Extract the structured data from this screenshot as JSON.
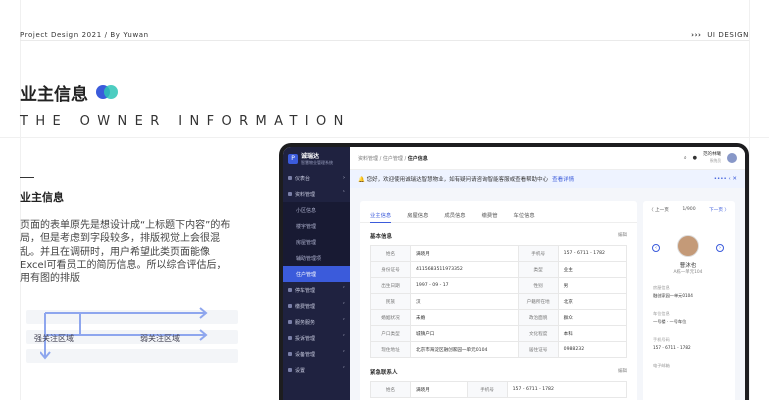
{
  "topbar": {
    "left": "Project Design 2021 / By Yuwan",
    "right_mark": "›››",
    "right": "UI DESIGN"
  },
  "heading": {
    "title": "业主信息",
    "subtitle": "THE OWNER INFORMATION"
  },
  "section": {
    "title": "业主信息",
    "desc": "页面的表单原先是想设计成“上标题下内容”的布局，但是考虑到字段较多，排版视觉上会很混乱。并且在调研时，用户希望此类页面能像Excel可看员工的简历信息。所以综合评估后，用有图的排版"
  },
  "legend": {
    "strong": "强关注区域",
    "weak": "弱关注区域"
  },
  "colors": {
    "blue": "#3b5bdb",
    "teal": "#2ec4b6",
    "sidebar": "#1f2240"
  },
  "app": {
    "brand": "诚瑞达",
    "brand_sub": "智慧物业管理系统",
    "menu": [
      {
        "label": "仪表台",
        "icon": "dashboard-icon"
      },
      {
        "label": "资料管理",
        "icon": "folder-icon",
        "open": true,
        "children": [
          "小区信息",
          "楼宇管理",
          "房屋管理",
          "辅助管理项",
          "住户管理"
        ],
        "active_child": "住户管理"
      },
      {
        "label": "停车管理",
        "icon": "car-icon"
      },
      {
        "label": "缴费管理",
        "icon": "bill-icon"
      },
      {
        "label": "服务服务",
        "icon": "service-icon"
      },
      {
        "label": "投诉管理",
        "icon": "complaint-icon"
      },
      {
        "label": "设备管理",
        "icon": "device-icon"
      },
      {
        "label": "设置",
        "icon": "gear-icon"
      }
    ],
    "breadcrumb": {
      "trail": "资料管理 / 住户管理 / ",
      "current": "住户信息"
    },
    "user": {
      "name": "范的林曦",
      "role": "系统员"
    },
    "notice": {
      "text": "您好，欢迎使用诚瑞达智慧物业，如有疑问请咨询智能客服或查看帮助中心",
      "link": "查看详情"
    },
    "tabs": [
      "业主信息",
      "房屋信息",
      "成员信息",
      "缴费管",
      "车位信息"
    ],
    "basic": {
      "title": "基本信息",
      "edit": "编辑",
      "rows": [
        [
          "姓名",
          "满晓月",
          "手机号",
          "157 - 6711 - 1782"
        ],
        [
          "身份证号",
          "4115683511973352",
          "类型",
          "业主"
        ],
        [
          "出生日期",
          "1997 - 09 - 17",
          "性别",
          "男"
        ],
        [
          "民族",
          "汉",
          "户籍所在地",
          "北京"
        ],
        [
          "婚姻状况",
          "未婚",
          "政治面貌",
          "群众"
        ],
        [
          "户口类型",
          "城镇户口",
          "文化程度",
          "本科"
        ],
        [
          "现住地址",
          "北京市海淀区融创家园一单元0104",
          "居住证号",
          "0988232"
        ]
      ]
    },
    "emergency": {
      "title": "紧急联系人",
      "edit": "编辑",
      "rows": [
        [
          "姓名",
          "满晓月",
          "手机号",
          "157 - 6711 - 1782"
        ]
      ]
    },
    "pager": {
      "prev": "〈 上一页",
      "count": "1/900",
      "next": "下一页 〉"
    },
    "profile": {
      "name": "曹沐也",
      "sub": "A栋一单元104",
      "fields": [
        {
          "k": "房屋信息",
          "v": "融创家园一单元0104"
        },
        {
          "k": "车位信息",
          "v": "一号楼 · 一号车位"
        },
        {
          "k": "手机号码",
          "v": "157 - 6711 - 1782"
        },
        {
          "k": "电子邮箱",
          "v": ""
        }
      ]
    }
  }
}
